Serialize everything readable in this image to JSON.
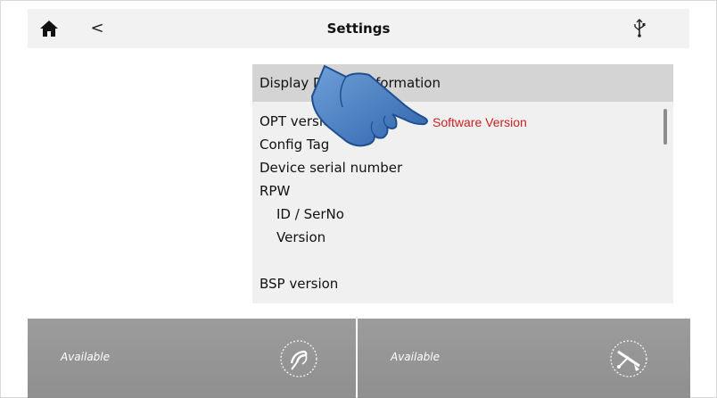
{
  "header": {
    "title": "Settings",
    "home_icon": "home-icon",
    "back_glyph": "<",
    "usb_icon": "usb-icon"
  },
  "panel": {
    "title": "Display Device Information",
    "items": [
      {
        "label": "OPT version"
      },
      {
        "label": "Config Tag"
      },
      {
        "label": "Device serial number"
      },
      {
        "label": "RPW"
      },
      {
        "label": "ID / SerNo"
      },
      {
        "label": "Version"
      },
      {
        "label": "BSP version"
      }
    ]
  },
  "overlay": {
    "callout": "Software Version",
    "callout_color": "#cc1f1f",
    "pointer_icon": "hand-pointer-icon"
  },
  "tiles": [
    {
      "status": "Available",
      "icon": "welding-torch-icon"
    },
    {
      "status": "Available",
      "icon": "crossed-torch-icon"
    }
  ]
}
